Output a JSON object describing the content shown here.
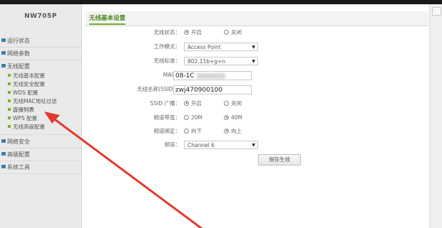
{
  "device": {
    "model": "NW705P"
  },
  "sidebar": {
    "sections": [
      {
        "label": "运行状态"
      },
      {
        "label": "网络参数"
      },
      {
        "label": "无线配置"
      }
    ],
    "sub_items": [
      {
        "label": "无线基本配置"
      },
      {
        "label": "无线安全配置"
      },
      {
        "label": "WDS 配置"
      },
      {
        "label": "无线MAC地址过滤"
      },
      {
        "label": "连接列表"
      },
      {
        "label": "WPS 配置"
      },
      {
        "label": "无线高级配置"
      }
    ],
    "bottom_sections": [
      {
        "label": "网络安全"
      },
      {
        "label": "高级配置"
      },
      {
        "label": "系统工具"
      }
    ]
  },
  "panel": {
    "title": "无线基本设置",
    "fields": {
      "wireless_status": {
        "label": "无线状态：",
        "options": [
          "开启",
          "关闭"
        ],
        "selected": "开启"
      },
      "work_mode": {
        "label": "工作模式：",
        "value": "Access Point"
      },
      "wireless_standard": {
        "label": "无线标准：",
        "value": "802.11b+g+n"
      },
      "mac": {
        "label": "MAC：",
        "value": "08-1C"
      },
      "ssid": {
        "label": "无线名称(SSID)：",
        "value": "zwj470900100"
      },
      "ssid_broadcast": {
        "label": "SSID 广播：",
        "options": [
          "开启",
          "关闭"
        ],
        "selected": "开启"
      },
      "bandwidth": {
        "label": "频道带宽：",
        "options": [
          "20M",
          "40M"
        ],
        "selected": "40M"
      },
      "channel_bind": {
        "label": "频道绑定：",
        "options": [
          "向下",
          "向上"
        ],
        "selected": "向上"
      },
      "channel": {
        "label": "频道：",
        "value": "Channel 6"
      }
    },
    "save_label": "保存生效"
  },
  "colors": {
    "accent_green": "#6fae2b",
    "nav_icon_blue": "#3b7fb5",
    "annotation_red": "#e23a2e"
  }
}
